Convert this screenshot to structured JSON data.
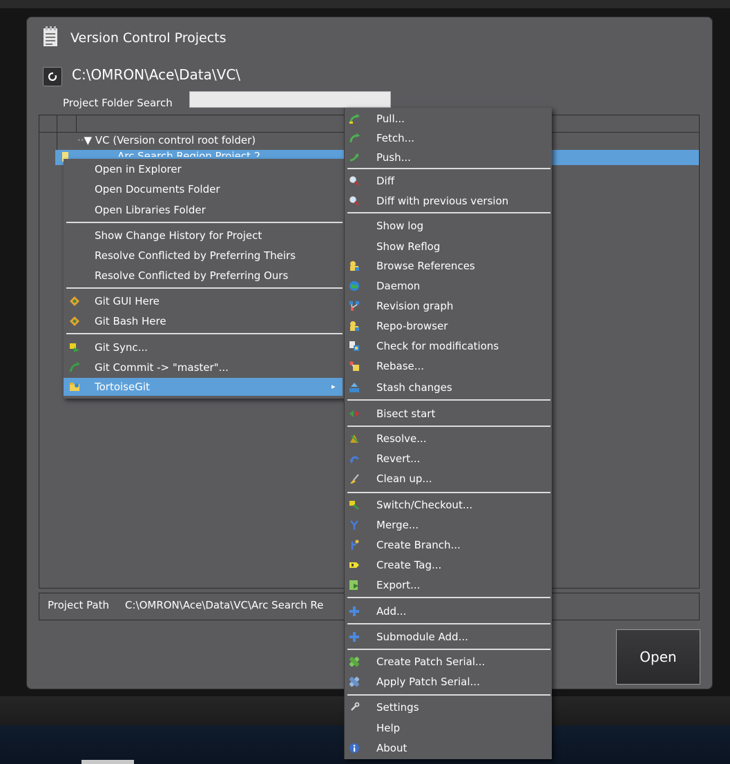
{
  "dialog": {
    "title": "Version Control Projects",
    "vc_path": "C:\\OMRON\\Ace\\Data\\VC\\",
    "search_label": "Project Folder Search",
    "search_value": "",
    "tree": {
      "root_label": "VC (Version control root folder)",
      "selected_item": "Arc Search Region Project 2"
    },
    "project_path_label": "Project Path",
    "project_path_value": "C:\\OMRON\\Ace\\Data\\VC\\Arc Search Re",
    "open_label": "Open"
  },
  "context_menu": {
    "group1": [
      "Open in Explorer",
      "Open Documents Folder",
      "Open Libraries Folder"
    ],
    "group2": [
      "Show Change History for Project",
      "Resolve Conflicted by Preferring Theirs",
      "Resolve Conflicted by Preferring Ours"
    ],
    "group3": [
      "Git GUI Here",
      "Git Bash Here"
    ],
    "group4": [
      "Git Sync...",
      "Git Commit -> \"master\"...",
      "TortoiseGit"
    ],
    "submenu_arrow": "▸"
  },
  "submenu": {
    "items": [
      "Pull...",
      "Fetch...",
      "Push...",
      "Diff",
      "Diff with previous version",
      "Show log",
      "Show Reflog",
      "Browse References",
      "Daemon",
      "Revision graph",
      "Repo-browser",
      "Check for modifications",
      "Rebase...",
      "Stash changes",
      "Bisect start",
      "Resolve...",
      "Revert...",
      "Clean up...",
      "Switch/Checkout...",
      "Merge...",
      "Create Branch...",
      "Create Tag...",
      "Export...",
      "Add...",
      "Submodule Add...",
      "Create Patch Serial...",
      "Apply Patch Serial...",
      "Settings",
      "Help",
      "About"
    ]
  },
  "colors": {
    "dialog_bg": "#5b5b5e",
    "highlight": "#5d9fd9",
    "separator": "#dcdcdc"
  }
}
